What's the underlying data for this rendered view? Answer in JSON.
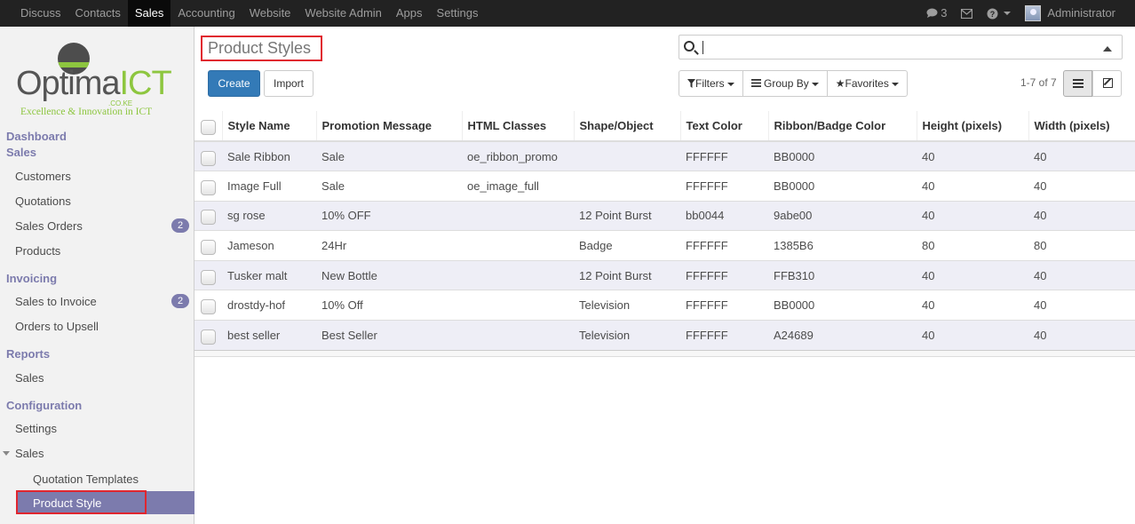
{
  "topnav": {
    "items": [
      "Discuss",
      "Contacts",
      "Sales",
      "Accounting",
      "Website",
      "Website Admin",
      "Apps",
      "Settings"
    ],
    "active": "Sales",
    "messages_count": "3",
    "user": "Administrator"
  },
  "logo": {
    "brand_left": "Optima",
    "brand_right": "ICT",
    "domain": ".CO.KE",
    "tagline": "Excellence & Innovation in ICT"
  },
  "sidebar": {
    "dashboard": "Dashboard",
    "sales_header": "Sales",
    "customers": "Customers",
    "quotations": "Quotations",
    "sales_orders": "Sales Orders",
    "sales_orders_badge": "2",
    "products": "Products",
    "invoicing_header": "Invoicing",
    "sales_to_invoice": "Sales to Invoice",
    "sales_to_invoice_badge": "2",
    "orders_to_upsell": "Orders to Upsell",
    "reports_header": "Reports",
    "reports_sales": "Sales",
    "configuration_header": "Configuration",
    "settings": "Settings",
    "config_sales": "Sales",
    "quotation_templates": "Quotation Templates",
    "product_style": "Product Style"
  },
  "page": {
    "title": "Product Styles",
    "create": "Create",
    "import": "Import",
    "filters": "Filters",
    "group_by": "Group By",
    "favorites": "Favorites",
    "pager": "1-7 of 7"
  },
  "table": {
    "columns": [
      "Style Name",
      "Promotion Message",
      "HTML Classes",
      "Shape/Object",
      "Text Color",
      "Ribbon/Badge Color",
      "Height (pixels)",
      "Width (pixels)"
    ],
    "rows": [
      [
        "Sale Ribbon",
        "Sale",
        "oe_ribbon_promo",
        "",
        "FFFFFF",
        "BB0000",
        "40",
        "40"
      ],
      [
        "Image Full",
        "Sale",
        "oe_image_full",
        "",
        "FFFFFF",
        "BB0000",
        "40",
        "40"
      ],
      [
        "sg rose",
        "10% OFF",
        "",
        "12 Point Burst",
        "bb0044",
        "9abe00",
        "40",
        "40"
      ],
      [
        "Jameson",
        "24Hr",
        "",
        "Badge",
        "FFFFFF",
        "1385B6",
        "80",
        "80"
      ],
      [
        "Tusker malt",
        "New Bottle",
        "",
        "12 Point Burst",
        "FFFFFF",
        "FFB310",
        "40",
        "40"
      ],
      [
        "drostdy-hof",
        "10% Off",
        "",
        "Television",
        "FFFFFF",
        "BB0000",
        "40",
        "40"
      ],
      [
        "best seller",
        "Best Seller",
        "",
        "Television",
        "FFFFFF",
        "A24689",
        "40",
        "40"
      ]
    ]
  }
}
